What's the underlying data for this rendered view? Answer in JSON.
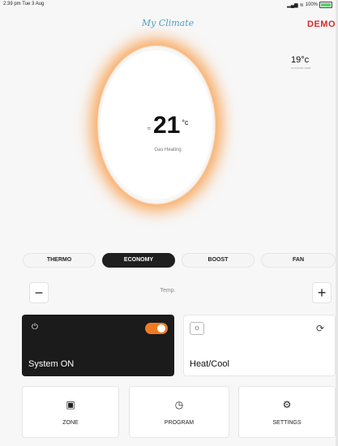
{
  "status": {
    "time": "2:39 pm",
    "date": "Tue 3 Aug",
    "battery": "100%"
  },
  "header": {
    "title": "My Climate",
    "demo": "DEMO"
  },
  "outside": {
    "temp": "19°c",
    "label": "OUTDOOR TEMP"
  },
  "dial": {
    "temp": "21",
    "unit": "°c",
    "mode_text": "Gas Heating",
    "wifi_icon": "wifi-icon"
  },
  "modes": [
    {
      "label": "THERMO",
      "active": false
    },
    {
      "label": "ECONOMY",
      "active": true
    },
    {
      "label": "BOOST",
      "active": false
    },
    {
      "label": "FAN",
      "active": false
    }
  ],
  "temp_control": {
    "minus": "−",
    "label": "Temp.",
    "plus": "+"
  },
  "tiles": {
    "system": {
      "label": "System ON",
      "icon": "power-icon",
      "toggle_on": true,
      "accent": "#f07a22"
    },
    "heatcool": {
      "label": "Heat/Cool",
      "icon": "sun-icon",
      "refresh_icon": "refresh-icon"
    }
  },
  "nav": [
    {
      "label": "ZONE",
      "icon": "grid-icon"
    },
    {
      "label": "PROGRAM",
      "icon": "clock-icon"
    },
    {
      "label": "SETTINGS",
      "icon": "gear-icon"
    }
  ]
}
